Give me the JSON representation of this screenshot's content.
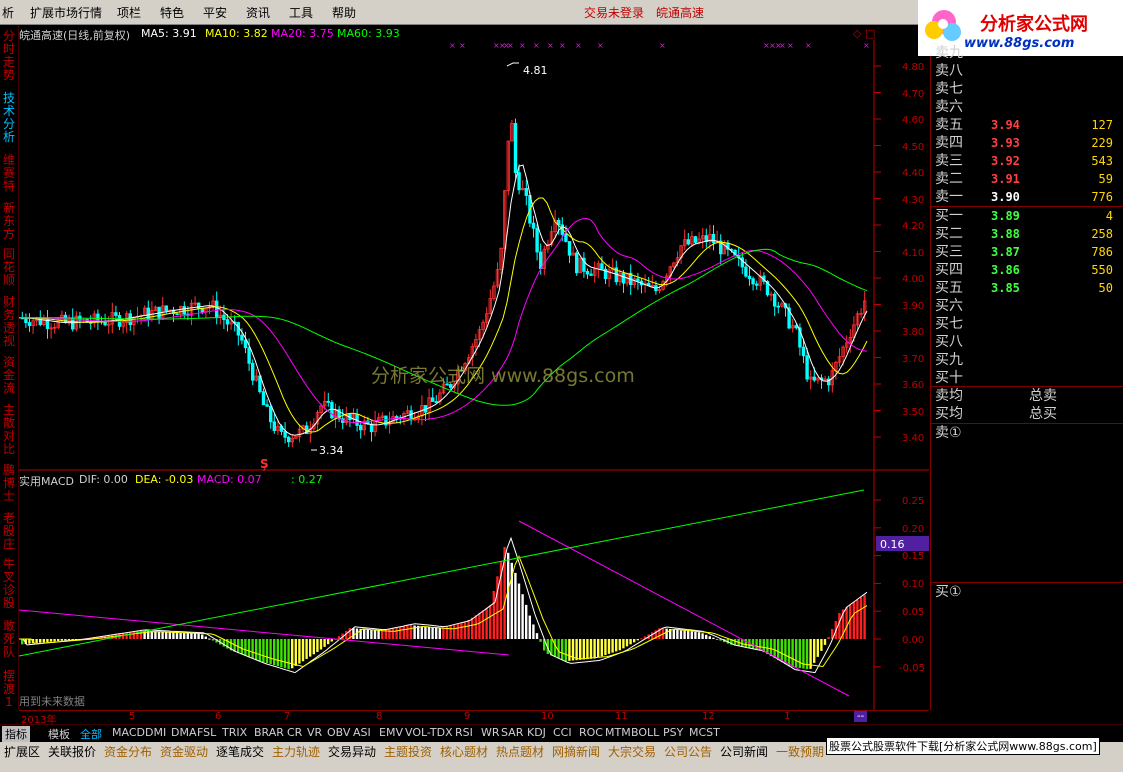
{
  "menu": {
    "items": [
      "析",
      "扩展市场行情",
      "项栏",
      "特色",
      "平安",
      "资讯",
      "工具",
      "帮助"
    ],
    "login_status": "交易未登录",
    "stock_name": "皖通高速"
  },
  "logo": {
    "title": "分析家公式网",
    "url": "www.88gs.com"
  },
  "left_tabs": [
    "分时走势",
    "技术分析",
    "维赛特",
    "新东方",
    "同花顺",
    "财务透视",
    "资金流",
    "主散对比",
    "鹏博士",
    "老股庄",
    "牛叉诊股",
    "敢死队",
    "摆渡1"
  ],
  "price_chart": {
    "header": {
      "title": "皖通高速(日线,前复权)",
      "ma5": "MA5: 3.91",
      "ma10": "MA10: 3.82",
      "ma20": "MA20: 3.75",
      "ma60": "MA60: 3.93"
    },
    "y_ticks": [
      "4.80",
      "4.70",
      "4.60",
      "4.50",
      "4.40",
      "4.30",
      "4.20",
      "4.10",
      "4.00",
      "3.90",
      "3.80",
      "3.70",
      "3.60",
      "3.50",
      "3.40"
    ],
    "high_label": "4.81",
    "low_label": "3.34",
    "watermark": "分析家公式网 www.88gs.com"
  },
  "macd_chart": {
    "header": {
      "title": "实用MACD",
      "dif": "DIF: 0.00",
      "dea": "DEA: -0.03",
      "macd": "MACD: 0.07",
      "extra": ": 0.27"
    },
    "y_ticks": [
      "0.25",
      "0.20",
      "0.15",
      "0.10",
      "0.05",
      "0.00",
      "-0.05"
    ],
    "current_value": "0.16",
    "note": "用到未来数据"
  },
  "time_axis": [
    "2013年",
    "5",
    "6",
    "7",
    "8",
    "9",
    "10",
    "11",
    "12",
    "1"
  ],
  "period_label": "日线",
  "orderbook": {
    "asks_top": [
      "卖九",
      "卖八",
      "卖七",
      "卖六"
    ],
    "asks": [
      {
        "label": "卖五",
        "price": "3.94",
        "vol": "127"
      },
      {
        "label": "卖四",
        "price": "3.93",
        "vol": "229"
      },
      {
        "label": "卖三",
        "price": "3.92",
        "vol": "543"
      },
      {
        "label": "卖二",
        "price": "3.91",
        "vol": "59"
      },
      {
        "label": "卖一",
        "price": "3.90",
        "vol": "776"
      }
    ],
    "bids": [
      {
        "label": "买一",
        "price": "3.89",
        "vol": "4"
      },
      {
        "label": "买二",
        "price": "3.88",
        "vol": "258"
      },
      {
        "label": "买三",
        "price": "3.87",
        "vol": "786"
      },
      {
        "label": "买四",
        "price": "3.86",
        "vol": "550"
      },
      {
        "label": "买五",
        "price": "3.85",
        "vol": "50"
      }
    ],
    "bids_bottom": [
      "买六",
      "买七",
      "买八",
      "买九",
      "买十"
    ],
    "avg_sell": "卖均",
    "avg_buy": "买均",
    "total_sell": "总卖",
    "total_buy": "总买",
    "sell_marker": "卖①",
    "buy_marker": "买①"
  },
  "indicator_tabs": [
    "指标",
    "模板",
    "全部",
    "MACD",
    "DMI",
    "DMA",
    "FSL",
    "TRIX",
    "BRAR",
    "CR",
    "VR",
    "OBV",
    "ASI",
    "EMV",
    "VOL-TDX",
    "RSI",
    "WR",
    "SAR",
    "KDJ",
    "CCI",
    "ROC",
    "MTM",
    "BOLL",
    "PSY",
    "MCST"
  ],
  "bottom_tabs": [
    "扩展区",
    "关联报价",
    "资金分布",
    "资金驱动",
    "逐笔成交",
    "主力轨迹",
    "交易异动",
    "主题投资",
    "核心题材",
    "热点题材",
    "网摘新闻",
    "大宗交易",
    "公司公告",
    "公司新闻",
    "一致预期"
  ],
  "banner": "股票公式股票软件下载[分析家公式网www.88gs.com]",
  "colors": {
    "up": "#ff3030",
    "down": "#00ffff",
    "ma5": "#ffffff",
    "ma10": "#ffff00",
    "ma20": "#ff00ff",
    "ma60": "#00ff00",
    "axis": "#c00000"
  }
}
